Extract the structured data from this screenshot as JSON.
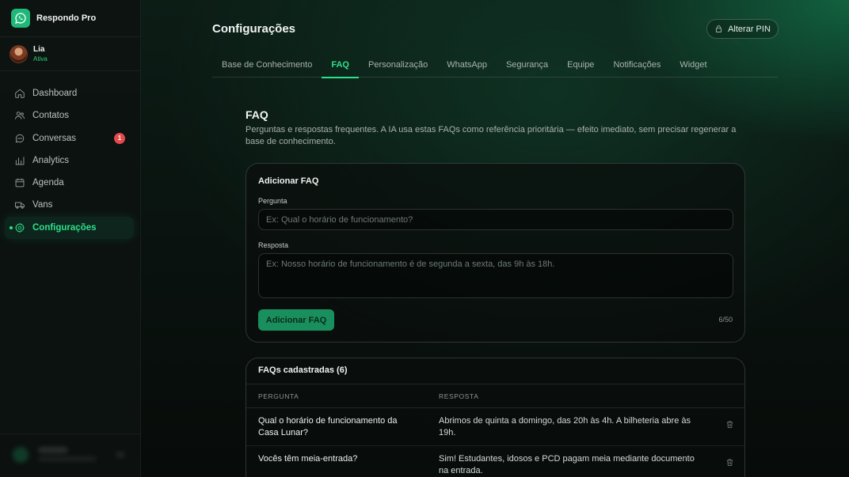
{
  "app": {
    "name": "Respondo Pro"
  },
  "user": {
    "name": "Lia",
    "status": "Ativa"
  },
  "sidebar": {
    "items": [
      {
        "label": "Dashboard",
        "icon": "home-icon"
      },
      {
        "label": "Contatos",
        "icon": "users-icon"
      },
      {
        "label": "Conversas",
        "icon": "chat-icon",
        "badge": "1"
      },
      {
        "label": "Analytics",
        "icon": "bar-chart-icon"
      },
      {
        "label": "Agenda",
        "icon": "calendar-icon"
      },
      {
        "label": "Vans",
        "icon": "van-icon"
      },
      {
        "label": "Configurações",
        "icon": "gear-icon",
        "active": true
      }
    ]
  },
  "header": {
    "title": "Configurações",
    "pin_button": "Alterar PIN"
  },
  "tabs": [
    {
      "label": "Base de Conhecimento"
    },
    {
      "label": "FAQ",
      "active": true
    },
    {
      "label": "Personalização"
    },
    {
      "label": "WhatsApp"
    },
    {
      "label": "Segurança"
    },
    {
      "label": "Equipe"
    },
    {
      "label": "Notificações"
    },
    {
      "label": "Widget"
    }
  ],
  "section": {
    "title": "FAQ",
    "description": "Perguntas e respostas frequentes. A IA usa estas FAQs como referência prioritária — efeito imediato, sem precisar regenerar a base de conhecimento."
  },
  "add_form": {
    "title": "Adicionar FAQ",
    "question_label": "Pergunta",
    "question_placeholder": "Ex: Qual o horário de funcionamento?",
    "answer_label": "Resposta",
    "answer_placeholder": "Ex: Nosso horário de funcionamento é de segunda a sexta, das 9h às 18h.",
    "submit_label": "Adicionar FAQ",
    "counter": "6/50"
  },
  "faq_list": {
    "title": "FAQs cadastradas (6)",
    "columns": [
      "PERGUNTA",
      "RESPOSTA"
    ],
    "rows": [
      {
        "question": "Qual o horário de funcionamento da Casa Lunar?",
        "answer": "Abrimos de quinta a domingo, das 20h às 4h. A bilheteria abre às 19h."
      },
      {
        "question": "Vocês têm meia-entrada?",
        "answer": "Sim! Estudantes, idosos e PCD pagam meia mediante documento na entrada."
      }
    ]
  },
  "colors": {
    "accent": "#2de08a",
    "badge": "#e5484d",
    "button": "#1a8f5e"
  }
}
